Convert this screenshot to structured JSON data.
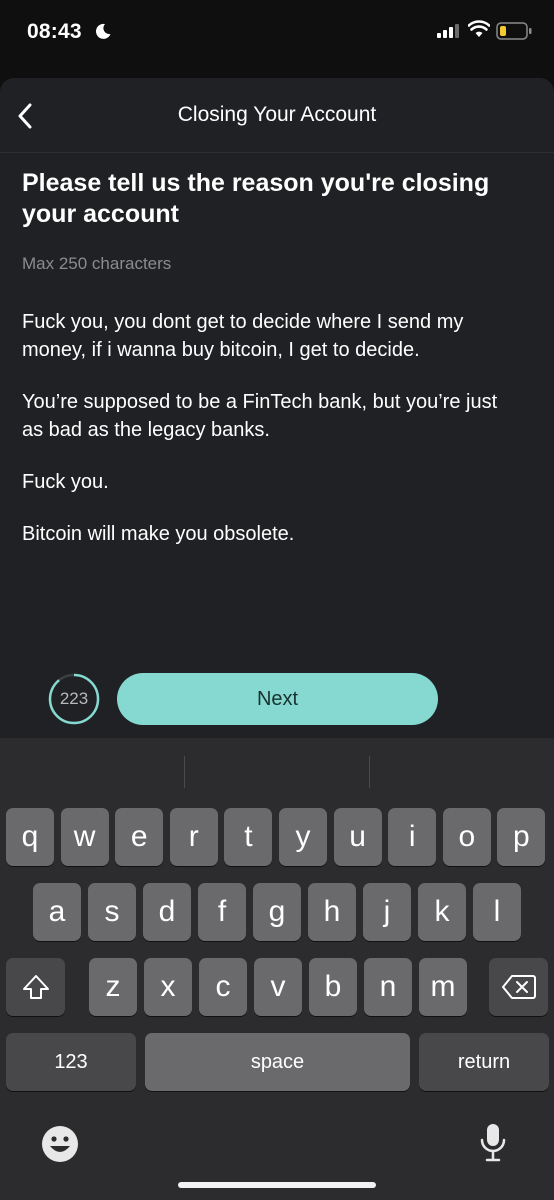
{
  "status_bar": {
    "time": "08:43",
    "moon": "moon-icon",
    "signal": "signal-icon",
    "wifi": "wifi-icon",
    "battery": "battery-icon"
  },
  "nav": {
    "title": "Closing Your Account",
    "back_icon": "chevron-left-icon"
  },
  "form": {
    "heading": "Please tell us the reason you're closing your account",
    "hint": "Max 250 characters",
    "message": [
      "Fuck you, you dont get to decide where I send my money, if i wanna buy bitcoin, I get to decide.",
      "You’re supposed to be a FinTech bank, but you’re just as bad as the legacy banks.",
      "Fuck you.",
      "Bitcoin will make you obsolete."
    ],
    "remaining_count": "223",
    "remaining_fraction": 0.892,
    "next_label": "Next"
  },
  "keyboard": {
    "row1": [
      "q",
      "w",
      "e",
      "r",
      "t",
      "y",
      "u",
      "i",
      "o",
      "p"
    ],
    "row2": [
      "a",
      "s",
      "d",
      "f",
      "g",
      "h",
      "j",
      "k",
      "l"
    ],
    "row3": [
      "z",
      "x",
      "c",
      "v",
      "b",
      "n",
      "m"
    ],
    "numbers_label": "123",
    "space_label": "space",
    "return_label": "return",
    "shift_icon": "shift-icon",
    "delete_icon": "backspace-icon",
    "emoji_icon": "emoji-icon",
    "mic_icon": "microphone-icon"
  },
  "colors": {
    "background": "#0f0f10",
    "sheet": "#202124",
    "accent": "#85d9d1",
    "key": "#6a6a6d",
    "key_dark": "#48484b"
  }
}
